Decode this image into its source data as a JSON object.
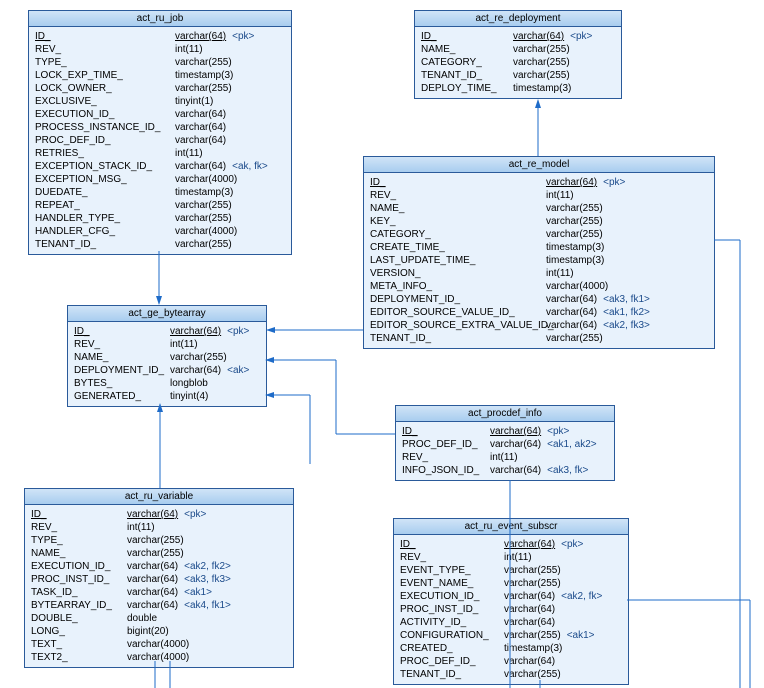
{
  "entities": {
    "act_ru_job": {
      "title": "act_ru_job",
      "cols": [
        {
          "n": "ID_",
          "t": "varchar(64)",
          "x": "<pk>",
          "pk": true
        },
        {
          "n": "REV_",
          "t": "int(11)"
        },
        {
          "n": "TYPE_",
          "t": "varchar(255)"
        },
        {
          "n": "LOCK_EXP_TIME_",
          "t": "timestamp(3)"
        },
        {
          "n": "LOCK_OWNER_",
          "t": "varchar(255)"
        },
        {
          "n": "EXCLUSIVE_",
          "t": "tinyint(1)"
        },
        {
          "n": "EXECUTION_ID_",
          "t": "varchar(64)"
        },
        {
          "n": "PROCESS_INSTANCE_ID_",
          "t": "varchar(64)"
        },
        {
          "n": "PROC_DEF_ID_",
          "t": "varchar(64)"
        },
        {
          "n": "RETRIES_",
          "t": "int(11)"
        },
        {
          "n": "EXCEPTION_STACK_ID_",
          "t": "varchar(64)",
          "x": "<ak, fk>"
        },
        {
          "n": "EXCEPTION_MSG_",
          "t": "varchar(4000)"
        },
        {
          "n": "DUEDATE_",
          "t": "timestamp(3)"
        },
        {
          "n": "REPEAT_",
          "t": "varchar(255)"
        },
        {
          "n": "HANDLER_TYPE_",
          "t": "varchar(255)"
        },
        {
          "n": "HANDLER_CFG_",
          "t": "varchar(4000)"
        },
        {
          "n": "TENANT_ID_",
          "t": "varchar(255)"
        }
      ]
    },
    "act_re_deployment": {
      "title": "act_re_deployment",
      "cols": [
        {
          "n": "ID_",
          "t": "varchar(64)",
          "x": "<pk>",
          "pk": true
        },
        {
          "n": "NAME_",
          "t": "varchar(255)"
        },
        {
          "n": "CATEGORY_",
          "t": "varchar(255)"
        },
        {
          "n": "TENANT_ID_",
          "t": "varchar(255)"
        },
        {
          "n": "DEPLOY_TIME_",
          "t": "timestamp(3)"
        }
      ]
    },
    "act_re_model": {
      "title": "act_re_model",
      "cols": [
        {
          "n": "ID_",
          "t": "varchar(64)",
          "x": "<pk>",
          "pk": true
        },
        {
          "n": "REV_",
          "t": "int(11)"
        },
        {
          "n": "NAME_",
          "t": "varchar(255)"
        },
        {
          "n": "KEY_",
          "t": "varchar(255)"
        },
        {
          "n": "CATEGORY_",
          "t": "varchar(255)"
        },
        {
          "n": "CREATE_TIME_",
          "t": "timestamp(3)"
        },
        {
          "n": "LAST_UPDATE_TIME_",
          "t": "timestamp(3)"
        },
        {
          "n": "VERSION_",
          "t": "int(11)"
        },
        {
          "n": "META_INFO_",
          "t": "varchar(4000)"
        },
        {
          "n": "DEPLOYMENT_ID_",
          "t": "varchar(64)",
          "x": "<ak3, fk1>"
        },
        {
          "n": "EDITOR_SOURCE_VALUE_ID_",
          "t": "varchar(64)",
          "x": "<ak1, fk2>"
        },
        {
          "n": "EDITOR_SOURCE_EXTRA_VALUE_ID_",
          "t": "varchar(64)",
          "x": "<ak2, fk3>"
        },
        {
          "n": "TENANT_ID_",
          "t": "varchar(255)"
        }
      ]
    },
    "act_ge_bytearray": {
      "title": "act_ge_bytearray",
      "cols": [
        {
          "n": "ID_",
          "t": "varchar(64)",
          "x": "<pk>",
          "pk": true
        },
        {
          "n": "REV_",
          "t": "int(11)"
        },
        {
          "n": "NAME_",
          "t": "varchar(255)"
        },
        {
          "n": "DEPLOYMENT_ID_",
          "t": "varchar(64)",
          "x": "<ak>"
        },
        {
          "n": "BYTES_",
          "t": "longblob"
        },
        {
          "n": "GENERATED_",
          "t": "tinyint(4)"
        }
      ]
    },
    "act_procdef_info": {
      "title": "act_procdef_info",
      "cols": [
        {
          "n": "ID_",
          "t": "varchar(64)",
          "x": "<pk>",
          "pk": true
        },
        {
          "n": "PROC_DEF_ID_",
          "t": "varchar(64)",
          "x": "<ak1, ak2>"
        },
        {
          "n": "REV_",
          "t": "int(11)"
        },
        {
          "n": "INFO_JSON_ID_",
          "t": "varchar(64)",
          "x": "<ak3, fk>"
        }
      ]
    },
    "act_ru_variable": {
      "title": "act_ru_variable",
      "cols": [
        {
          "n": "ID_",
          "t": "varchar(64)",
          "x": "<pk>",
          "pk": true
        },
        {
          "n": "REV_",
          "t": "int(11)"
        },
        {
          "n": "TYPE_",
          "t": "varchar(255)"
        },
        {
          "n": "NAME_",
          "t": "varchar(255)"
        },
        {
          "n": "EXECUTION_ID_",
          "t": "varchar(64)",
          "x": "<ak2, fk2>"
        },
        {
          "n": "PROC_INST_ID_",
          "t": "varchar(64)",
          "x": "<ak3, fk3>"
        },
        {
          "n": "TASK_ID_",
          "t": "varchar(64)",
          "x": "<ak1>"
        },
        {
          "n": "BYTEARRAY_ID_",
          "t": "varchar(64)",
          "x": "<ak4, fk1>"
        },
        {
          "n": "DOUBLE_",
          "t": "double"
        },
        {
          "n": "LONG_",
          "t": "bigint(20)"
        },
        {
          "n": "TEXT_",
          "t": "varchar(4000)"
        },
        {
          "n": "TEXT2_",
          "t": "varchar(4000)"
        }
      ]
    },
    "act_ru_event_subscr": {
      "title": "act_ru_event_subscr",
      "cols": [
        {
          "n": "ID_",
          "t": "varchar(64)",
          "x": "<pk>",
          "pk": true
        },
        {
          "n": "REV_",
          "t": "int(11)"
        },
        {
          "n": "EVENT_TYPE_",
          "t": "varchar(255)"
        },
        {
          "n": "EVENT_NAME_",
          "t": "varchar(255)"
        },
        {
          "n": "EXECUTION_ID_",
          "t": "varchar(64)",
          "x": "<ak2, fk>"
        },
        {
          "n": "PROC_INST_ID_",
          "t": "varchar(64)"
        },
        {
          "n": "ACTIVITY_ID_",
          "t": "varchar(64)"
        },
        {
          "n": "CONFIGURATION_",
          "t": "varchar(255)",
          "x": "<ak1>"
        },
        {
          "n": "CREATED_",
          "t": "timestamp(3)"
        },
        {
          "n": "PROC_DEF_ID_",
          "t": "varchar(64)"
        },
        {
          "n": "TENANT_ID_",
          "t": "varchar(255)"
        }
      ]
    }
  }
}
